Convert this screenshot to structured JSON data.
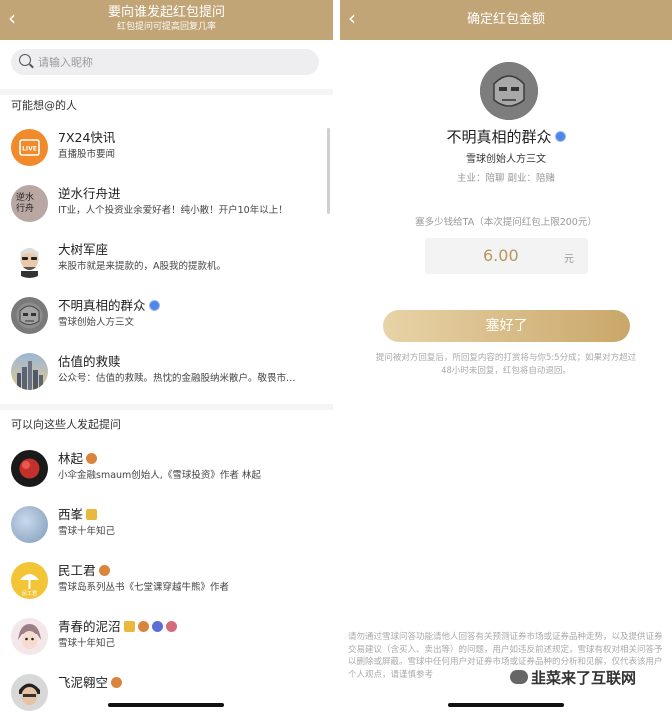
{
  "left": {
    "header": {
      "title": "要向谁发起红包提问",
      "subtitle": "红包提问可提高回复几率"
    },
    "search": {
      "placeholder": "请输入昵称"
    },
    "section1_title": "可能想@的人",
    "suggested": [
      {
        "name": "7X24快讯",
        "desc": "直播股市要闻",
        "avatar_text": "LIVE"
      },
      {
        "name": "逆水行舟进",
        "desc": "IT业，人个投资业余爱好者！纯小散！开户10年以上！",
        "avatar_text": "逆水 行舟"
      },
      {
        "name": "大树军座",
        "desc": "来股市就是来提款的，A股我的提款机。"
      },
      {
        "name": "不明真相的群众",
        "desc": "雪球创始人方三文",
        "verified": true
      },
      {
        "name": "估值的救赎",
        "desc": "公众号：估值的救赎。热忱的金融股纳米散户。敬畏市…"
      }
    ],
    "section2_title": "可以向这些人发起提问",
    "askable": [
      {
        "name": "林起",
        "desc": "小伞金融smaum创始人,《雪球投资》作者  林起"
      },
      {
        "name": "西峯",
        "desc": "雪球十年知己"
      },
      {
        "name": "民工君",
        "desc": "雪球岛系列丛书《七堂课穿越牛熊》作者",
        "avatar_text": "民工君"
      },
      {
        "name": "青春的泥沼",
        "desc": "雪球十年知己"
      },
      {
        "name": "飞泥翱空",
        "desc": ""
      }
    ]
  },
  "right": {
    "header": {
      "title": "确定红包金额"
    },
    "profile": {
      "name": "不明真相的群众",
      "subtitle": "雪球创始人方三文",
      "role": "主业：陪聊  副业：陪赌"
    },
    "prompt": "塞多少钱给TA（本次提问红包上限200元）",
    "amount": {
      "value": "6.00",
      "unit": "元"
    },
    "submit_label": "塞好了",
    "note": "提问被对方回复后，所回复内容的打赏将与你5:5分成；如果对方超过48小时未回复，红包将自动退回。",
    "disclaimer": "请勿通过雪球问答功能请他人回答有关预测证券市场或证券品种走势，以及提供证券交易建议（含买入、卖出等）的问题，用户如违反前述规定，雪球有权对相关问答予以删除或屏蔽。雪球中任何用户对证券市场或证券品种的分析和见解，仅代表该用户个人观点，请谨慎参考",
    "watermark": "韭菜来了互联网"
  },
  "colors": {
    "header_gold": "#c2a577",
    "verified_blue": "#4f86e8",
    "amount_gold": "#b8975d"
  }
}
